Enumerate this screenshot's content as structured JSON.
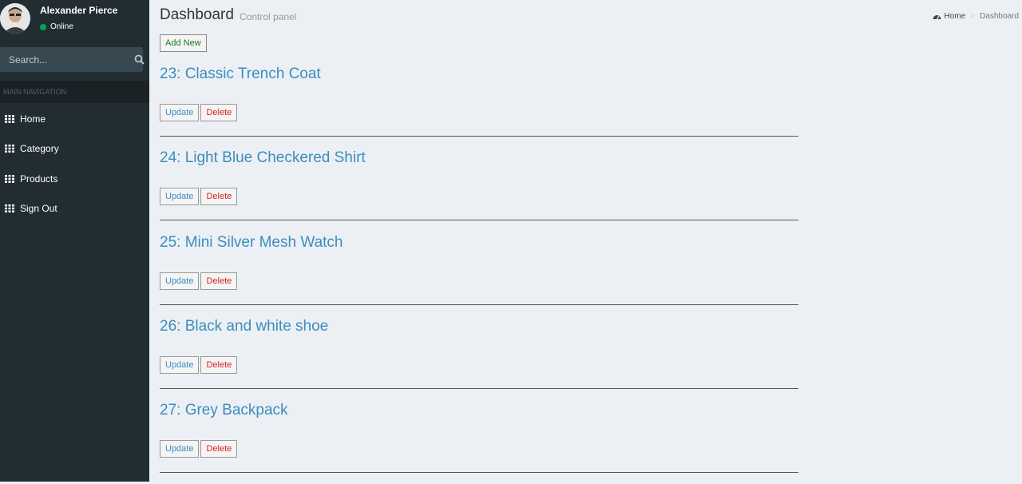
{
  "user": {
    "name": "Alexander Pierce",
    "status": "Online"
  },
  "search": {
    "placeholder": "Search..."
  },
  "nav": {
    "header": "MAIN NAVIGATION",
    "items": [
      {
        "label": "Home",
        "icon": "grid-icon"
      },
      {
        "label": "Category",
        "icon": "grid-icon"
      },
      {
        "label": "Products",
        "icon": "grid-icon"
      },
      {
        "label": "Sign Out",
        "icon": "grid-icon"
      }
    ]
  },
  "header": {
    "title": "Dashboard",
    "subtitle": "Control panel"
  },
  "breadcrumb": {
    "home": "Home",
    "current": "Dashboard"
  },
  "toolbar": {
    "add_label": "Add New"
  },
  "products": [
    {
      "title": "23: Classic Trench Coat",
      "update": "Update",
      "delete": "Delete"
    },
    {
      "title": "24: Light Blue Checkered Shirt",
      "update": "Update",
      "delete": "Delete"
    },
    {
      "title": "25: Mini Silver Mesh Watch",
      "update": "Update",
      "delete": "Delete"
    },
    {
      "title": "26: Black and white shoe",
      "update": "Update",
      "delete": "Delete"
    },
    {
      "title": "27: Grey Backpack",
      "update": "Update",
      "delete": "Delete"
    }
  ],
  "colors": {
    "sidebar": "#222d32",
    "link": "#3c8dbc",
    "delete": "#dd2222",
    "add": "#1f7a1f",
    "online": "#00a65a"
  }
}
